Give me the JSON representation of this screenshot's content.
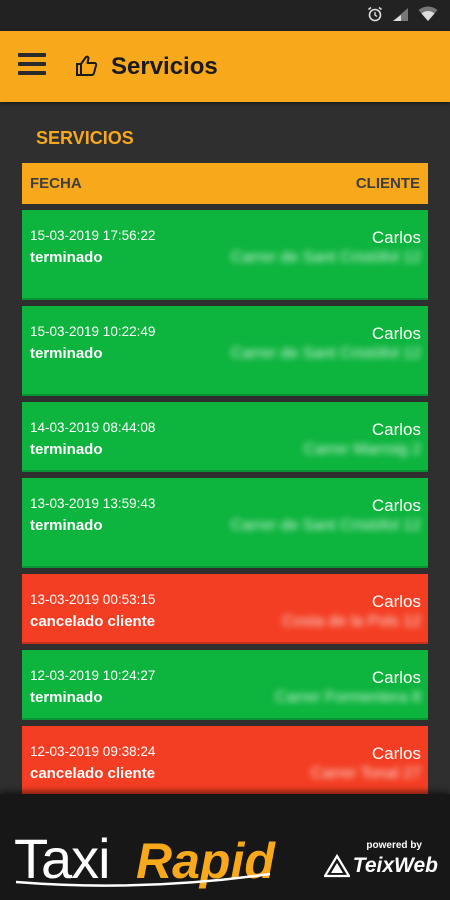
{
  "header": {
    "title": "Servicios",
    "menu_icon": "menu-icon",
    "title_icon": "thumbs-up-icon"
  },
  "section_title": "SERVICIOS",
  "table": {
    "col_date": "FECHA",
    "col_client": "CLIENTE"
  },
  "services": [
    {
      "date": "15-03-2019 17:56:22",
      "status": "terminado",
      "client": "Carlos",
      "address": "Carrer de Sant Cristòfol 12",
      "color": "#0db43e"
    },
    {
      "date": "15-03-2019 10:22:49",
      "status": "terminado",
      "client": "Carlos",
      "address": "Carrer de Sant Cristòfol 12",
      "color": "#0db43e"
    },
    {
      "date": "14-03-2019 08:44:08",
      "status": "terminado",
      "client": "Carlos",
      "address": "Carrer Marroig 2",
      "color": "#0db43e"
    },
    {
      "date": "13-03-2019 13:59:43",
      "status": "terminado",
      "client": "Carlos",
      "address": "Carrer de Sant Cristòfol 12",
      "color": "#0db43e"
    },
    {
      "date": "13-03-2019 00:53:15",
      "status": "cancelado cliente",
      "client": "Carlos",
      "address": "Costa de la Pols 12",
      "color": "#f43e23"
    },
    {
      "date": "12-03-2019 10:24:27",
      "status": "terminado",
      "client": "Carlos",
      "address": "Carrer Formentera 8",
      "color": "#0db43e"
    },
    {
      "date": "12-03-2019 09:38:24",
      "status": "cancelado cliente",
      "client": "Carlos",
      "address": "Carrer Tonal 27",
      "color": "#f43e23"
    }
  ],
  "footer": {
    "brand_left": "Taxi",
    "brand_right": "Rapid",
    "powered_by": "powered by",
    "partner": "TeixWeb"
  },
  "colors": {
    "accent": "#f7a81b",
    "completed": "#0db43e",
    "cancelled": "#f43e23",
    "background": "#2f2f2f"
  }
}
